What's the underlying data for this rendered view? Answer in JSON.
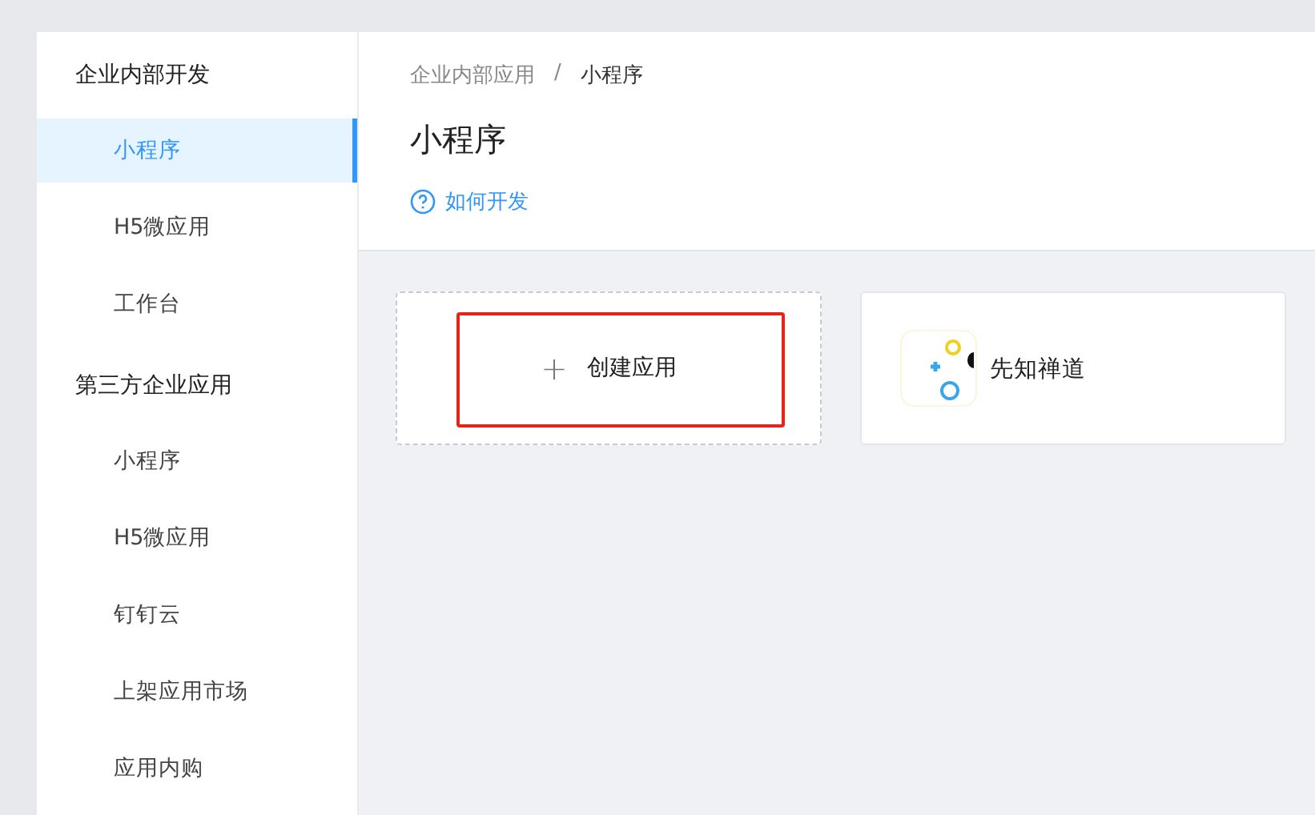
{
  "sidebar": {
    "groups": [
      {
        "title": "企业内部开发",
        "items": [
          {
            "label": "小程序",
            "selected": true
          },
          {
            "label": "H5微应用",
            "selected": false
          },
          {
            "label": "工作台",
            "selected": false
          }
        ]
      },
      {
        "title": "第三方企业应用",
        "items": [
          {
            "label": "小程序",
            "selected": false
          },
          {
            "label": "H5微应用",
            "selected": false
          },
          {
            "label": "钉钉云",
            "selected": false
          },
          {
            "label": "上架应用市场",
            "selected": false
          },
          {
            "label": "应用内购",
            "selected": false
          }
        ]
      }
    ]
  },
  "breadcrumb": [
    "企业内部应用",
    "/",
    "小程序"
  ],
  "page_title": "小程序",
  "help_link": "如何开发",
  "cards": [
    {
      "kind": "create",
      "icon": "+",
      "label": "创建应用",
      "highlighted": true
    },
    {
      "kind": "app",
      "label": "先知禅道"
    }
  ]
}
